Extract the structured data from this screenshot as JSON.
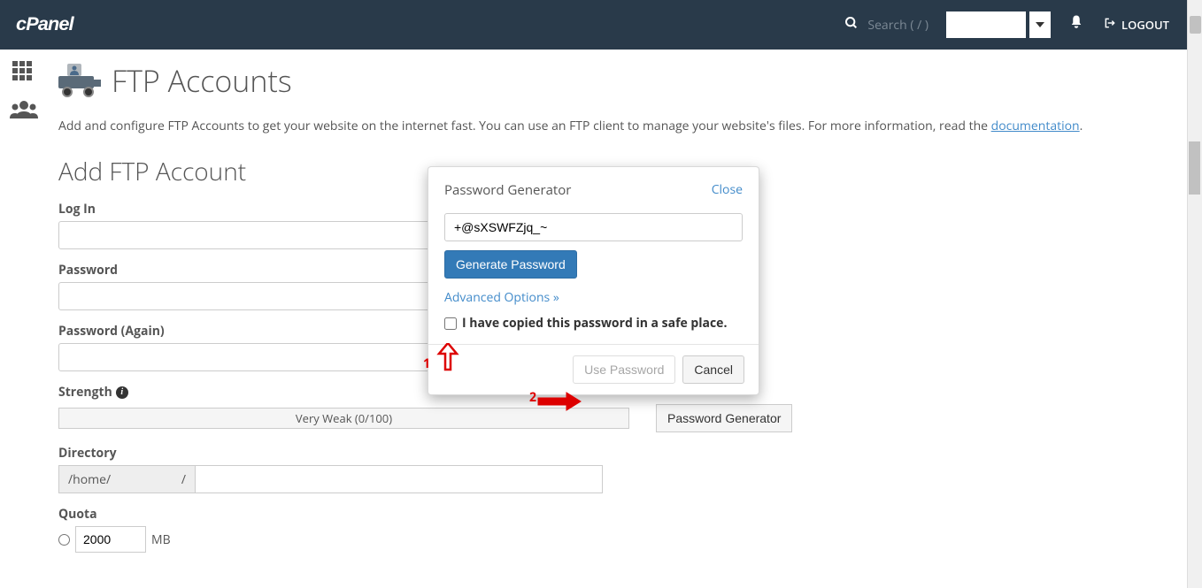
{
  "header": {
    "brand": "cPanel",
    "search_placeholder": "Search ( / )",
    "logout": "LOGOUT"
  },
  "page": {
    "title": "FTP Accounts",
    "intro_prefix": "Add and configure FTP Accounts to get your website on the internet fast. You can use an FTP client to manage your website's files. For more information, read the ",
    "intro_link": "documentation",
    "intro_suffix": "."
  },
  "form": {
    "heading": "Add FTP Account",
    "login_label": "Log In",
    "login_value": "",
    "password_label": "Password",
    "password_value": "",
    "password_again_label": "Password (Again)",
    "password_again_value": "",
    "strength_label": "Strength",
    "strength_text": "Very Weak (0/100)",
    "gen_button": "Password Generator",
    "directory_label": "Directory",
    "directory_prefix_left": "/home/",
    "directory_prefix_right": "/",
    "directory_value": "",
    "quota_label": "Quota",
    "quota_value": "2000",
    "quota_unit": "MB"
  },
  "modal": {
    "title": "Password Generator",
    "close": "Close",
    "password_value": "+@sXSWFZjq_~",
    "generate": "Generate Password",
    "advanced": "Advanced Options »",
    "confirm": "I have copied this password in a safe place.",
    "use": "Use Password",
    "cancel": "Cancel"
  },
  "annotations": {
    "num1": "1",
    "num2": "2"
  }
}
